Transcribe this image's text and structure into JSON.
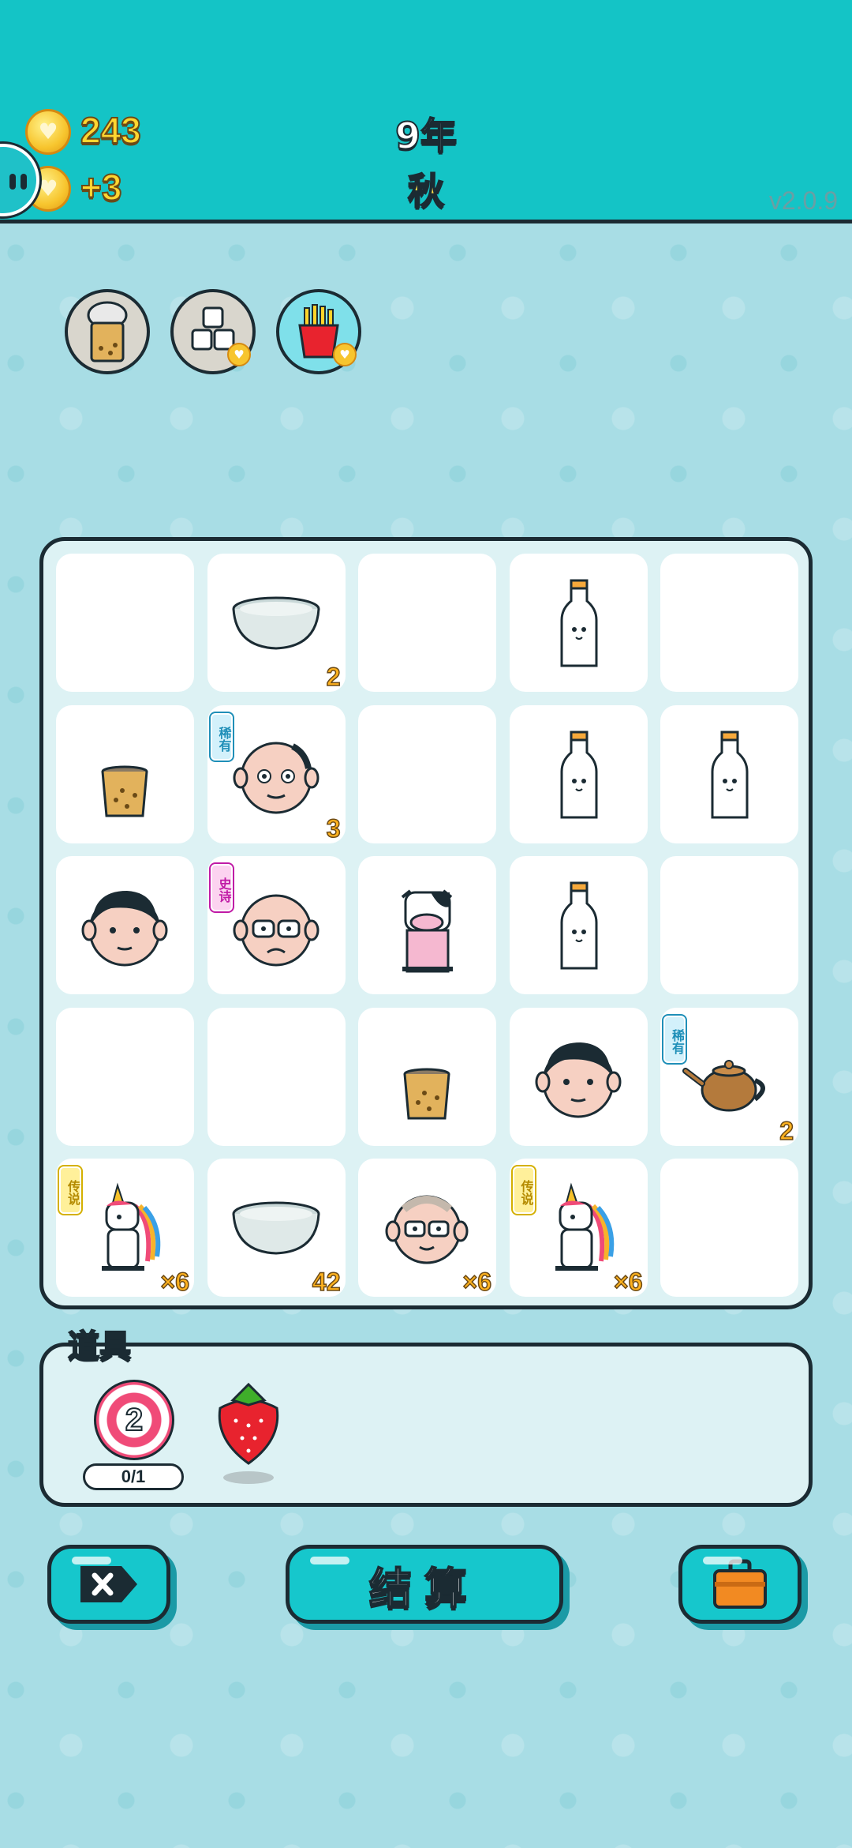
{
  "header": {
    "coins": "243",
    "income": "+3",
    "year": "9年",
    "season": "秋",
    "version": "v2.0.9"
  },
  "orders": [
    {
      "name": "bubble-tea-with-lid-icon"
    },
    {
      "name": "sugar-cubes-icon"
    },
    {
      "name": "fries-icon"
    }
  ],
  "board": {
    "cells": [
      {
        "item": "",
        "tag": "",
        "count": ""
      },
      {
        "item": "bowl-icon",
        "tag": "",
        "count": "2"
      },
      {
        "item": "",
        "tag": "",
        "count": ""
      },
      {
        "item": "milk-bottle-icon",
        "tag": "",
        "count": ""
      },
      {
        "item": "",
        "tag": "",
        "count": ""
      },
      {
        "item": "bubble-tea-cup-icon",
        "tag": "",
        "count": ""
      },
      {
        "item": "bald-man-icon",
        "tag": "稀有",
        "count": "3"
      },
      {
        "item": "",
        "tag": "",
        "count": ""
      },
      {
        "item": "milk-bottle-icon",
        "tag": "",
        "count": ""
      },
      {
        "item": "milk-bottle-icon",
        "tag": "",
        "count": ""
      },
      {
        "item": "young-man-icon",
        "tag": "",
        "count": ""
      },
      {
        "item": "old-man-glasses-icon",
        "tag": "史诗",
        "count": ""
      },
      {
        "item": "cow-icon",
        "tag": "",
        "count": ""
      },
      {
        "item": "milk-bottle-icon",
        "tag": "",
        "count": ""
      },
      {
        "item": "",
        "tag": "",
        "count": ""
      },
      {
        "item": "",
        "tag": "",
        "count": ""
      },
      {
        "item": "",
        "tag": "",
        "count": ""
      },
      {
        "item": "bubble-tea-cup-icon",
        "tag": "",
        "count": ""
      },
      {
        "item": "young-man-icon",
        "tag": "",
        "count": ""
      },
      {
        "item": "teapot-icon",
        "tag": "稀有",
        "count": "2"
      },
      {
        "item": "unicorn-icon",
        "tag": "传说",
        "count": "×6"
      },
      {
        "item": "bowl-icon",
        "tag": "",
        "count": "42"
      },
      {
        "item": "grandpa-glasses-icon",
        "tag": "",
        "count": "×6"
      },
      {
        "item": "unicorn-icon",
        "tag": "传说",
        "count": "×6"
      },
      {
        "item": "",
        "tag": "",
        "count": ""
      }
    ]
  },
  "props": {
    "title": "道具",
    "target_count": "2",
    "target_progress": "0/1"
  },
  "buttons": {
    "settle_label": "结算"
  }
}
